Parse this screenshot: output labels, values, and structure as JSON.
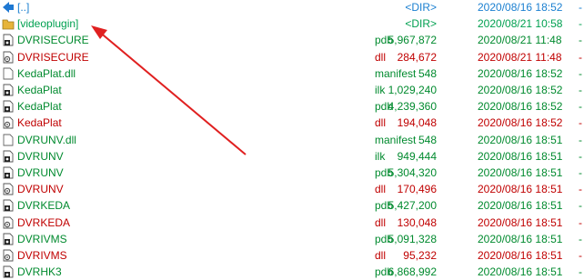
{
  "files": [
    {
      "name": "[..]",
      "ext": "",
      "size": "<DIR>",
      "date": "2020/08/16 18:52",
      "attr": "-",
      "kind": "up",
      "color": "dot"
    },
    {
      "name": "[videoplugin]",
      "ext": "",
      "size": "<DIR>",
      "date": "2020/08/21 10:58",
      "attr": "-",
      "kind": "folder",
      "color": "dir"
    },
    {
      "name": "DVRISECURE",
      "ext": "pdb",
      "size": "5,967,872",
      "date": "2020/08/21 11:48",
      "attr": "-",
      "kind": "pdb",
      "color": "pdb"
    },
    {
      "name": "DVRISECURE",
      "ext": "dll",
      "size": "284,672",
      "date": "2020/08/21 11:48",
      "attr": "-",
      "kind": "dll",
      "color": "dll"
    },
    {
      "name": "KedaPlat.dll",
      "ext": "manifest",
      "size": "548",
      "date": "2020/08/16 18:52",
      "attr": "-",
      "kind": "doc",
      "color": "man"
    },
    {
      "name": "KedaPlat",
      "ext": "ilk",
      "size": "1,029,240",
      "date": "2020/08/16 18:52",
      "attr": "-",
      "kind": "pdb",
      "color": "ilk"
    },
    {
      "name": "KedaPlat",
      "ext": "pdb",
      "size": "4,239,360",
      "date": "2020/08/16 18:52",
      "attr": "-",
      "kind": "pdb",
      "color": "pdb"
    },
    {
      "name": "KedaPlat",
      "ext": "dll",
      "size": "194,048",
      "date": "2020/08/16 18:52",
      "attr": "-",
      "kind": "dll",
      "color": "dll"
    },
    {
      "name": "DVRUNV.dll",
      "ext": "manifest",
      "size": "548",
      "date": "2020/08/16 18:51",
      "attr": "-",
      "kind": "doc",
      "color": "man"
    },
    {
      "name": "DVRUNV",
      "ext": "ilk",
      "size": "949,444",
      "date": "2020/08/16 18:51",
      "attr": "-",
      "kind": "pdb",
      "color": "ilk"
    },
    {
      "name": "DVRUNV",
      "ext": "pdb",
      "size": "5,304,320",
      "date": "2020/08/16 18:51",
      "attr": "-",
      "kind": "pdb",
      "color": "pdb"
    },
    {
      "name": "DVRUNV",
      "ext": "dll",
      "size": "170,496",
      "date": "2020/08/16 18:51",
      "attr": "-",
      "kind": "dll",
      "color": "dll"
    },
    {
      "name": "DVRKEDA",
      "ext": "pdb",
      "size": "5,427,200",
      "date": "2020/08/16 18:51",
      "attr": "-",
      "kind": "pdb",
      "color": "pdb"
    },
    {
      "name": "DVRKEDA",
      "ext": "dll",
      "size": "130,048",
      "date": "2020/08/16 18:51",
      "attr": "-",
      "kind": "dll",
      "color": "dll"
    },
    {
      "name": "DVRIVMS",
      "ext": "pdb",
      "size": "5,091,328",
      "date": "2020/08/16 18:51",
      "attr": "-",
      "kind": "pdb",
      "color": "pdb"
    },
    {
      "name": "DVRIVMS",
      "ext": "dll",
      "size": "95,232",
      "date": "2020/08/16 18:51",
      "attr": "-",
      "kind": "dll",
      "color": "dll"
    },
    {
      "name": "DVRHK3",
      "ext": "pdb",
      "size": "6,868,992",
      "date": "2020/08/16 18:51",
      "attr": "-",
      "kind": "pdb",
      "color": "pdb"
    }
  ],
  "annotation": {
    "arrow_color": "#e02020"
  },
  "colors": {
    "dir": "#00a050",
    "pdb": "#008a2e",
    "dll": "#c00000",
    "man": "#008a2e",
    "ilk": "#008a2e",
    "dot": "#1a7fd0"
  }
}
